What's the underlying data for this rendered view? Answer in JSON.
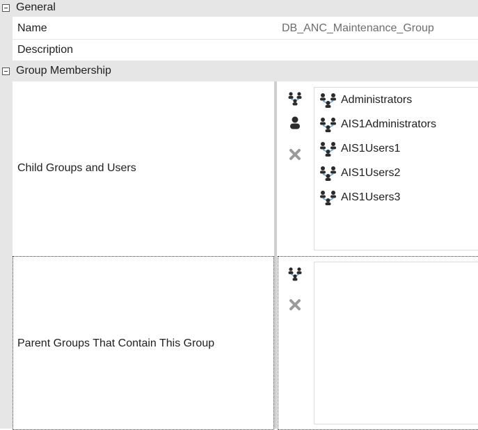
{
  "categories": {
    "general": {
      "label": "General"
    },
    "membership": {
      "label": "Group Membership"
    }
  },
  "properties": {
    "name": {
      "label": "Name",
      "value": "DB_ANC_Maintenance_Group"
    },
    "description": {
      "label": "Description",
      "value": ""
    },
    "child": {
      "label": "Child Groups and Users"
    },
    "parent": {
      "label": "Parent Groups That Contain This Group"
    }
  },
  "child_members": [
    {
      "label": "Administrators",
      "icon": "group-icon"
    },
    {
      "label": "AIS1Administrators",
      "icon": "group-icon"
    },
    {
      "label": "AIS1Users1",
      "icon": "group-icon"
    },
    {
      "label": "AIS1Users2",
      "icon": "group-icon"
    },
    {
      "label": "AIS1Users3",
      "icon": "group-icon"
    }
  ],
  "parent_members": [],
  "colors": {
    "category_bg": "#e6e6e6",
    "icon_dark": "#2b2b2b",
    "icon_blue": "#6aa6d8",
    "remove_gray": "#9a9a9a"
  }
}
